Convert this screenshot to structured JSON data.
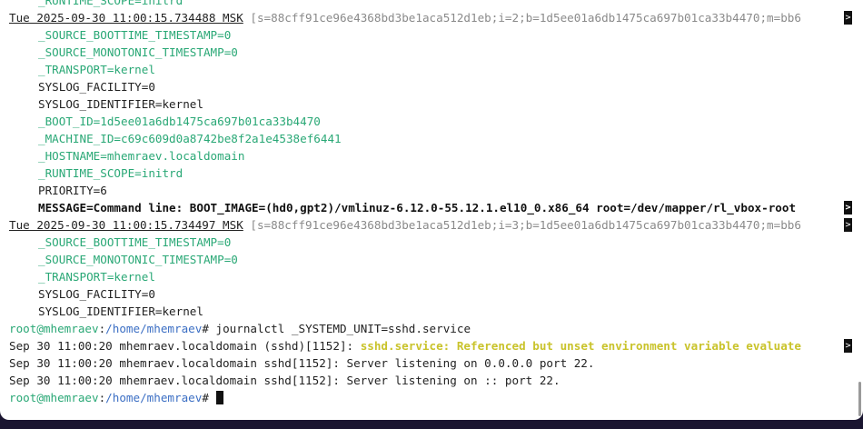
{
  "terminal": {
    "lines": [
      {
        "text": "_RUNTIME_SCOPE=initrd"
      },
      {
        "ts": "Tue 2025-09-30 11:00:15.734488 MSK",
        "cursor": "[s=88cff91ce96e4368bd3be1aca512d1eb;i=2;b=1d5ee01a6db1475ca697b01ca33b4470;m=bb6"
      },
      {
        "text": "_SOURCE_BOOTTIME_TIMESTAMP=0"
      },
      {
        "text": "_SOURCE_MONOTONIC_TIMESTAMP=0"
      },
      {
        "text": "_TRANSPORT=kernel"
      },
      {
        "text": "SYSLOG_FACILITY=0"
      },
      {
        "text": "SYSLOG_IDENTIFIER=kernel"
      },
      {
        "text": "_BOOT_ID=1d5ee01a6db1475ca697b01ca33b4470"
      },
      {
        "text": "_MACHINE_ID=c69c609d0a8742be8f2a1e4538ef6441"
      },
      {
        "text": "_HOSTNAME=mhemraev.localdomain"
      },
      {
        "text": "_RUNTIME_SCOPE=initrd"
      },
      {
        "text": "PRIORITY=6"
      },
      {
        "text": "MESSAGE=Command line: BOOT_IMAGE=(hd0,gpt2)/vmlinuz-6.12.0-55.12.1.el10_0.x86_64 root=/dev/mapper/rl_vbox-root"
      },
      {
        "ts": "Tue 2025-09-30 11:00:15.734497 MSK",
        "cursor": "[s=88cff91ce96e4368bd3be1aca512d1eb;i=3;b=1d5ee01a6db1475ca697b01ca33b4470;m=bb6"
      },
      {
        "text": "_SOURCE_BOOTTIME_TIMESTAMP=0"
      },
      {
        "text": "_SOURCE_MONOTONIC_TIMESTAMP=0"
      },
      {
        "text": "_TRANSPORT=kernel"
      },
      {
        "text": "SYSLOG_FACILITY=0"
      },
      {
        "text": "SYSLOG_IDENTIFIER=kernel"
      },
      {
        "user": "root@mhemraev",
        "sep": ":",
        "path": "/home/mhemraev",
        "sym": "# ",
        "cmd": "journalctl _SYSTEMD_UNIT=sshd.service"
      },
      {
        "prefix": "Sep 30 11:00:20 mhemraev.localdomain (sshd)[1152]: ",
        "warn": "sshd.service: Referenced but unset environment variable evaluate"
      },
      {
        "text": "Sep 30 11:00:20 mhemraev.localdomain sshd[1152]: Server listening on 0.0.0.0 port 22."
      },
      {
        "text": "Sep 30 11:00:20 mhemraev.localdomain sshd[1152]: Server listening on :: port 22."
      },
      {
        "user": "root@mhemraev",
        "sep": ":",
        "path": "/home/mhemraev",
        "sym": "# "
      }
    ],
    "truncation_marker": ">"
  }
}
